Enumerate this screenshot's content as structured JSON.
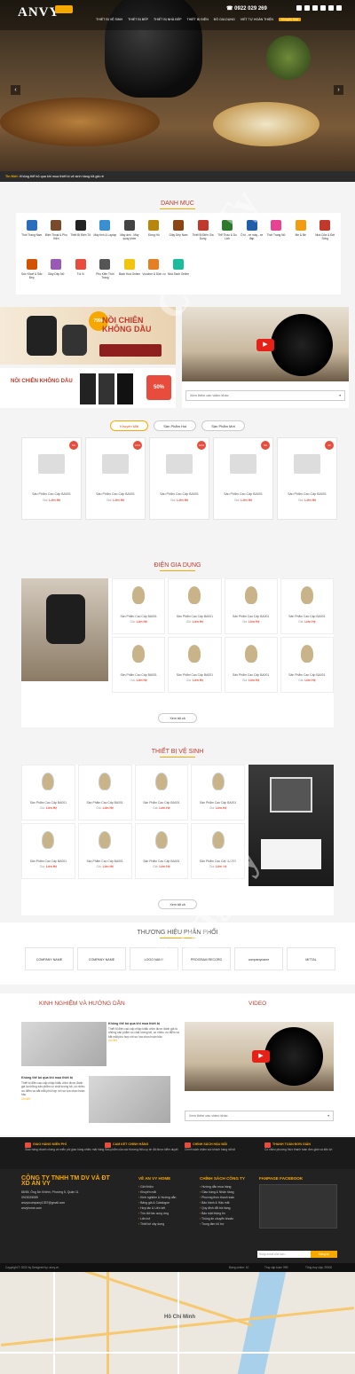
{
  "header": {
    "logo": "ANVY",
    "phone": "0922 029 269",
    "nav": [
      "THIẾT BỊ VỆ SINH",
      "THIẾT BỊ BẾP",
      "THIẾT BỊ NHÀ BẾP",
      "THIẾT BỊ ĐIỆN",
      "ĐỒ GIA DỤNG",
      "VIẾT TỰ HOÀN THIỆN",
      "Khuyến Mại"
    ]
  },
  "ticker": {
    "label": "Tin Mới:",
    "text": "Không thể bỏ qua khi mua thiết bị vệ sinh hàng tốt giá rẻ"
  },
  "categories": {
    "title": "DANH MỤC",
    "items": [
      "Thời Trang Nam",
      "Điện Thoại & Phụ Kiện",
      "Thiết Bị Điện Tử",
      "Máy tính & Laptop",
      "Máy ảnh - Máy quay phim",
      "Đồng Hồ",
      "Giày Dép Nam",
      "Thiết Bị Điện Gia Dụng",
      "Thể Thao & Du Lịch",
      "Ô tô - xe máy - xe đạp",
      "Thời Trang Nữ",
      "Mẹ & Bé",
      "Nhà Cửa & Đời Sống",
      "Sức Khoẻ & Sắc Đẹp",
      "Giày Dép Nữ",
      "Túi Ví",
      "Phụ Kiện Thời Trang",
      "Bách Hoá Online",
      "Voucher & Dịch vụ",
      "Nhà Sách Online"
    ]
  },
  "banner1": {
    "title": "NỒI CHIÊN KHÔNG DẦU",
    "price": "799k"
  },
  "banner2": {
    "title": "NỒI CHIÊN KHÔNG DẦU",
    "pct": "50%"
  },
  "video": {
    "select": "Xem thêm các video khác"
  },
  "tabs": [
    "Khuyến Mãi",
    "Sản Phẩm Hot",
    "Sản Phẩm Mới"
  ],
  "featured": [
    {
      "name": "Sản Phẩm Cao Cấp BA001",
      "badge": "5%"
    },
    {
      "name": "Sản Phẩm Cao Cấp BA001",
      "badge": "15%"
    },
    {
      "name": "Sản Phẩm Cao Cấp BA001",
      "badge": "10%"
    },
    {
      "name": "Sản Phẩm Cao Cấp BA001",
      "badge": "5%"
    },
    {
      "name": "Sản Phẩm Cao Cấp BA001",
      "badge": "20"
    }
  ],
  "price_label": "Giá:",
  "price_value": "Liên Hệ",
  "dgd": {
    "title": "ĐIỆN GIA DỤNG",
    "item": "Sản Phẩm Cao Cấp BA001",
    "more": "Xem tất cả"
  },
  "tbvs": {
    "title": "THIẾT BỊ VỆ SINH",
    "item": "Sản Phẩm Cao Cấp BA001",
    "more": "Xem tất cả"
  },
  "brands": {
    "title": "THƯƠNG HIỆU PHÂN PHỐI",
    "items": [
      "COMPANY NAME",
      "COMPANY NAME",
      "LOGO NAME",
      "PROGRAM RECORD",
      "companyname",
      "MITTAL"
    ]
  },
  "news": {
    "title": "KINH NGHIỆM VÀ HƯỚNG DẪN",
    "video_title": "VIDEO",
    "a1_title": "Không thể bỏ qua khi mua thiết bị",
    "a1_text": "Thiết bị điện cao cấp nhập khẩu chim được đánh giá là những sản phẩm có chất lượng tốt, có nhiều ưu điểm và bắt mắt phù hợp với sự lựa chọn hoàn hảo",
    "a1_more": "Chi tiết",
    "a2_title": "Không thể bỏ qua khi mua thiết bị",
    "a2_text": "Thiết bị điện cao cấp nhập khẩu chim được đánh giá là những sản phẩm có chất lượng tốt, có nhiều ưu điểm và bắt mắt phù hợp với sự lựa chọn hoàn hảo",
    "a2_more": "Chi tiết",
    "select": "Xem thêm các video khác"
  },
  "features": [
    {
      "title": "GIAO HÀNG MIỄN PHÍ",
      "text": "Giao hàng nhanh chóng và miễn phí giao hàng nhiều mặt hàng"
    },
    {
      "title": "CAM KẾT CHÍNH HÃNG",
      "text": "Sản phẩm của các thương hiệu uy tín đã được kiểm duyệt"
    },
    {
      "title": "CHÍNH SÁCH HẬU MÃI",
      "text": "Chính sách chăm sóc khách hàng rất tốt"
    },
    {
      "title": "THANH TOÁN ĐƠN GIẢN",
      "text": "Có nhiều phương thức thanh toán đơn giản và tiện lợi"
    }
  ],
  "footer": {
    "company": "CÔNG TY TNHH TM DV VÀ ĐT XD AN VY",
    "address": "86/65, Ông Ích Khiêm, Phường 5, Quận 11",
    "phone": "0923025089",
    "email": "anvyocompany1357@gmail.com",
    "web": "anvyhome.com",
    "col2_title": "VỀ AN VY HOME",
    "col2": [
      "Giới thiệu",
      "Khuyến mãi",
      "Kinh nghiệm & Hướng dẫn",
      "Bảng giá & Catalogue",
      "Hợp tác & Liên kết",
      "Tìm đối tác cung ứng",
      "Liên hệ",
      "Thiết kế xây dựng"
    ],
    "col3_title": "CHÍNH SÁCH CÔNG TY",
    "col3": [
      "Hướng dẫn mua hàng",
      "Giao hàng & Nhận hàng",
      "Phương thức thanh toán",
      "Bảo hành & Hậu mãi",
      "Quy định đổi trả hàng",
      "Bảo mật thông tin",
      "Thông tin chuyển khoản",
      "Trung tâm hỗ trợ"
    ],
    "col4_title": "FANPAGE FACEBOOK",
    "email_placeholder": "Nhập email của bạn...",
    "email_btn": "Đăng ký"
  },
  "copyright": {
    "text": "Copyright © 2020 by Designed by: anvy.vn",
    "online": "Đang online: 10",
    "week": "Truy cập tuần: 999",
    "total": "Tổng truy cập: 29000"
  },
  "map": {
    "city": "Hồ Chí Minh"
  }
}
